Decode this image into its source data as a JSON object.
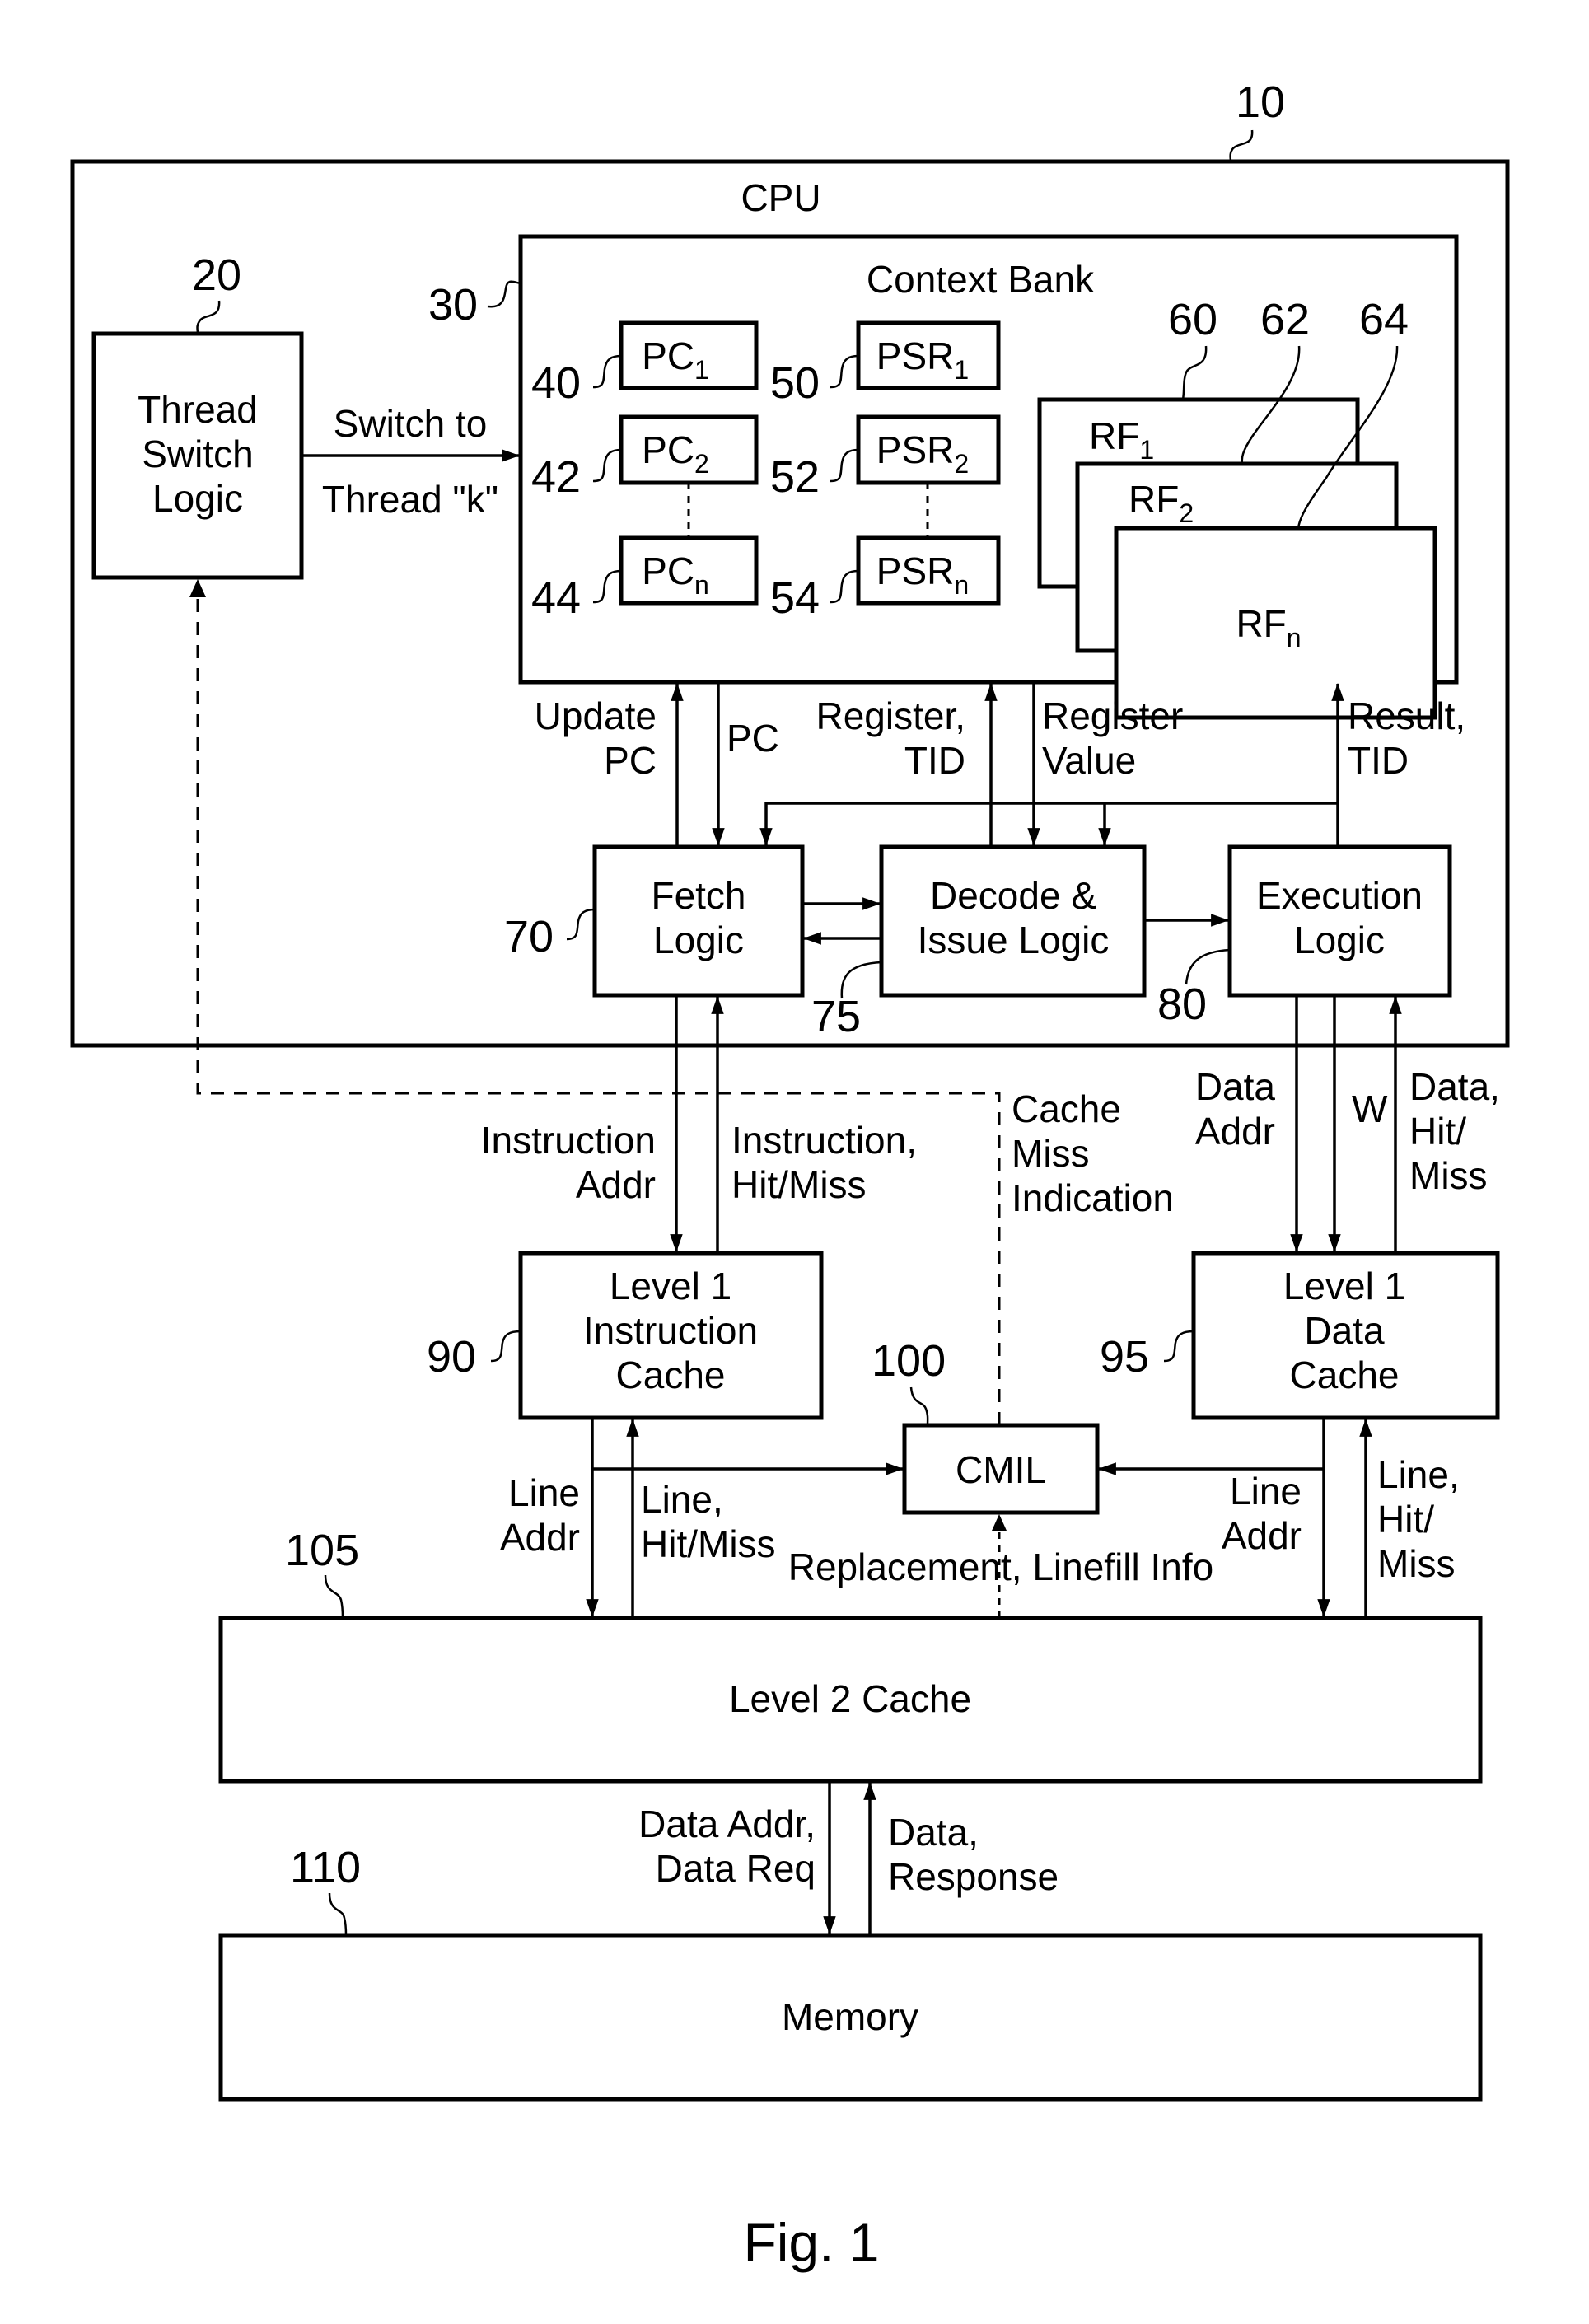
{
  "figure": {
    "caption": "Fig. 1",
    "system_ref": "10"
  },
  "cpu": {
    "title": "CPU",
    "thread_switch": {
      "ref": "20",
      "lines": [
        "Thread",
        "Switch",
        "Logic"
      ]
    },
    "switch_label": [
      "Switch to",
      "Thread \"k\""
    ],
    "context_bank": {
      "ref": "30",
      "title": "Context Bank",
      "pc_registers": [
        {
          "ref": "40",
          "base": "PC",
          "sub": "1"
        },
        {
          "ref": "42",
          "base": "PC",
          "sub": "2"
        },
        {
          "ref": "44",
          "base": "PC",
          "sub": "n"
        }
      ],
      "psr_registers": [
        {
          "ref": "50",
          "base": "PSR",
          "sub": "1"
        },
        {
          "ref": "52",
          "base": "PSR",
          "sub": "2"
        },
        {
          "ref": "54",
          "base": "PSR",
          "sub": "n"
        }
      ],
      "register_files": [
        {
          "ref": "60",
          "base": "RF",
          "sub": "1"
        },
        {
          "ref": "62",
          "base": "RF",
          "sub": "2"
        },
        {
          "ref": "64",
          "base": "RF",
          "sub": "n"
        }
      ]
    },
    "signals": {
      "update_pc": [
        "Update",
        "PC"
      ],
      "pc": "PC",
      "register_tid": [
        "Register,",
        "TID"
      ],
      "register_value": [
        "Register",
        "Value"
      ],
      "result_tid": [
        "Result,",
        "TID"
      ]
    },
    "fetch": {
      "ref": "70",
      "lines": [
        "Fetch",
        "Logic"
      ]
    },
    "decode": {
      "ref": "75",
      "lines": [
        "Decode &",
        "Issue Logic"
      ]
    },
    "execution": {
      "ref": "80",
      "lines": [
        "Execution",
        "Logic"
      ]
    }
  },
  "memory_system": {
    "l1_instruction": {
      "ref": "90",
      "lines": [
        "Level 1",
        "Instruction",
        "Cache"
      ]
    },
    "l1_data": {
      "ref": "95",
      "lines": [
        "Level 1",
        "Data",
        "Cache"
      ]
    },
    "cmil": {
      "ref": "100",
      "label": "CMIL"
    },
    "l2": {
      "ref": "105",
      "label": "Level 2 Cache"
    },
    "memory": {
      "ref": "110",
      "label": "Memory"
    },
    "signals": {
      "instruction_addr": [
        "Instruction",
        "Addr"
      ],
      "instruction_hit_miss": [
        "Instruction,",
        "Hit/Miss"
      ],
      "cache_miss_indication": [
        "Cache",
        "Miss",
        "Indication"
      ],
      "data_addr": [
        "Data",
        "Addr"
      ],
      "w": "W",
      "data_hit_miss": [
        "Data,",
        "Hit/",
        "Miss"
      ],
      "i_line_addr": [
        "Line",
        "Addr"
      ],
      "i_line_hit_miss": [
        "Line,",
        "Hit/Miss"
      ],
      "replacement_info": "Replacement, Linefill Info",
      "d_line_addr": [
        "Line",
        "Addr"
      ],
      "d_line_hit_miss": [
        "Line,",
        "Hit/",
        "Miss"
      ],
      "mem_request": [
        "Data Addr,",
        "Data Req"
      ],
      "mem_response": [
        "Data,",
        "Response"
      ]
    }
  }
}
